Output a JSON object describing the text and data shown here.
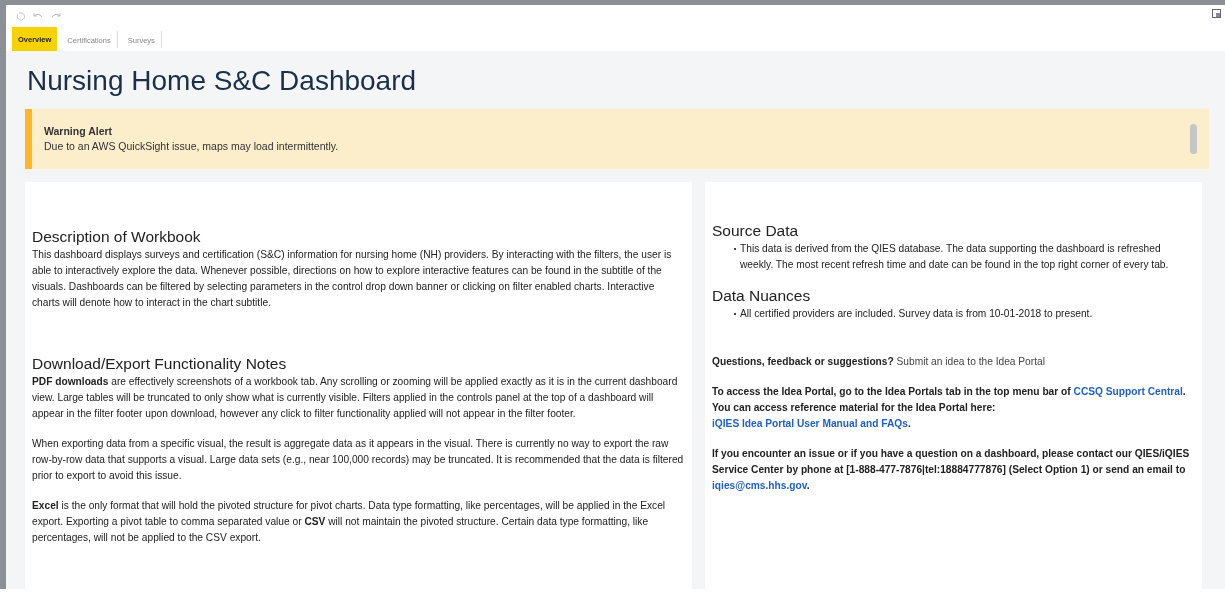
{
  "tabs": [
    {
      "label": "Overview",
      "selected": true
    },
    {
      "label": "Certifications",
      "selected": false
    },
    {
      "label": "Surveys",
      "selected": false
    }
  ],
  "title": "Nursing Home S&C Dashboard",
  "alert": {
    "heading": "Warning Alert",
    "message": "Due to an AWS QuickSight issue, maps may load intermittently."
  },
  "left_panel": {
    "sections": [
      {
        "heading": "Description of Workbook",
        "paragraphs": [
          [
            {
              "kind": "text",
              "text": "This dashboard displays surveys and certification (S&C) information for nursing home (NH) providers. By interacting with the filters, the user is able to interactively explore the data. Whenever possible, directions on how to explore interactive features can be found in the subtitle of the visuals. Dashboards can be filtered by selecting parameters in the control drop down banner or clicking on filter enabled charts. Interactive charts will denote how to interact in the chart subtitle."
            }
          ]
        ]
      },
      {
        "heading": "Download/Export Functionality Notes",
        "paragraphs": [
          [
            {
              "kind": "bold",
              "text": "PDF downloads"
            },
            {
              "kind": "text",
              "text": " are effectively screenshots of a workbook tab. Any scrolling or zooming will be applied exactly as it is in the current dashboard view. Large tables will be truncated to only show what is currently visible. Filters applied in the controls panel at the top of a dashboard will appear in the filter footer upon download, however any click to filter functionality applied will not appear in the filter footer."
            }
          ],
          [
            {
              "kind": "text",
              "text": "When exporting data from a specific visual, the result is aggregate data as it appears in the visual. There is currently no way to export the raw row-by-row data that supports a visual. Large data sets (e.g., near 100,000 records) may be truncated.  It is recommended that the data is filtered prior to export to avoid this issue."
            }
          ],
          [
            {
              "kind": "bold",
              "text": "Excel"
            },
            {
              "kind": "text",
              "text": " is the only format that will hold the pivoted structure for pivot charts. Data type formatting, like percentages, will be applied in the Excel export. Exporting a pivot table to comma separated value or "
            },
            {
              "kind": "bold",
              "text": "CSV"
            },
            {
              "kind": "text",
              "text": " will not maintain the pivoted structure. Certain data type formatting, like percentages, will not be applied to the CSV export."
            }
          ]
        ]
      }
    ]
  },
  "right_panel": {
    "sections": [
      {
        "heading": "Source Data",
        "bullets": [
          "This data is derived from the QIES database. The data supporting the dashboard is refreshed weekly. The most recent refresh time and date can be found in the top right corner of every tab."
        ]
      },
      {
        "heading": "Data Nuances",
        "bullets": [
          "All certified providers are included. Survey data is from 10-01-2018 to present."
        ]
      }
    ],
    "paragraphs": [
      [
        {
          "kind": "bold",
          "text": "Questions, feedback or suggestions?"
        },
        {
          "kind": "text",
          "text": " Submit an idea to the Idea Portal"
        }
      ],
      [
        {
          "kind": "bold",
          "text": "To access the Idea Portal, go to the Idea Portals tab in the top menu bar of "
        },
        {
          "kind": "link",
          "text": "CCSQ Support Central"
        },
        {
          "kind": "bold",
          "text": ". You can access reference material for the Idea Portal here: "
        },
        {
          "kind": "link",
          "text": "iQIES Idea Portal User Manual and FAQs"
        },
        {
          "kind": "bold",
          "text": "."
        }
      ],
      [
        {
          "kind": "bold",
          "text": "If you encounter an issue or if you have a question on a dashboard, please contact our QIES/iQIES Service Center by phone at [1-888-477-7876|tel:18884777876] (Select Option 1) or send an email to "
        },
        {
          "kind": "link",
          "text": "iqies@cms.hhs.gov"
        },
        {
          "kind": "bold",
          "text": "."
        }
      ]
    ]
  }
}
